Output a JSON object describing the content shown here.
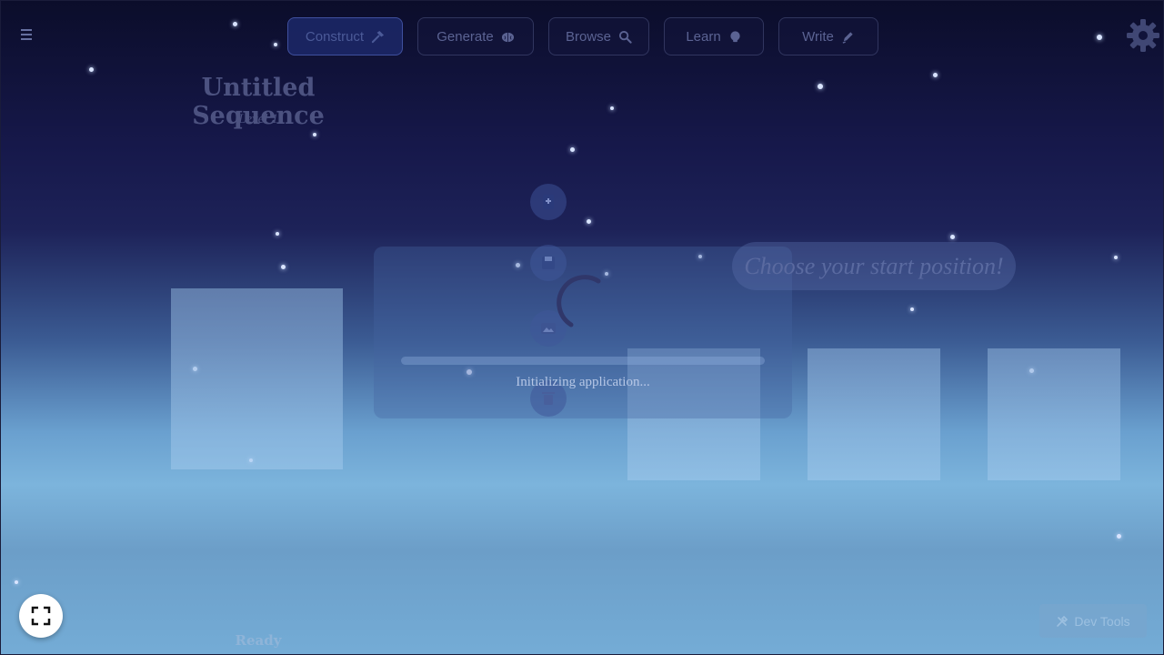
{
  "nav": {
    "menu_icon": "hamburger-icon",
    "tabs": [
      {
        "label": "Construct",
        "icon": "hammer-icon",
        "active": true
      },
      {
        "label": "Generate",
        "icon": "brain-icon",
        "active": false
      },
      {
        "label": "Browse",
        "icon": "search-icon",
        "active": false
      },
      {
        "label": "Learn",
        "icon": "lightbulb-icon",
        "active": false
      },
      {
        "label": "Write",
        "icon": "pen-icon",
        "active": false
      }
    ],
    "settings_icon": "gear-icon"
  },
  "sequence": {
    "title": "Untitled Sequence",
    "level": "Level 1"
  },
  "tools": [
    "add-book-icon",
    "save-icon",
    "image-icon",
    "delete-icon"
  ],
  "loading": {
    "text": "Initializing application...",
    "progress": 0
  },
  "start_prompt": "Choose your start position!",
  "status": "Ready",
  "dev_tools_label": "Dev Tools",
  "colors": {
    "accent": "#1c2869",
    "sky_top": "#0b0d2a",
    "sky_bottom": "#74acd6"
  }
}
